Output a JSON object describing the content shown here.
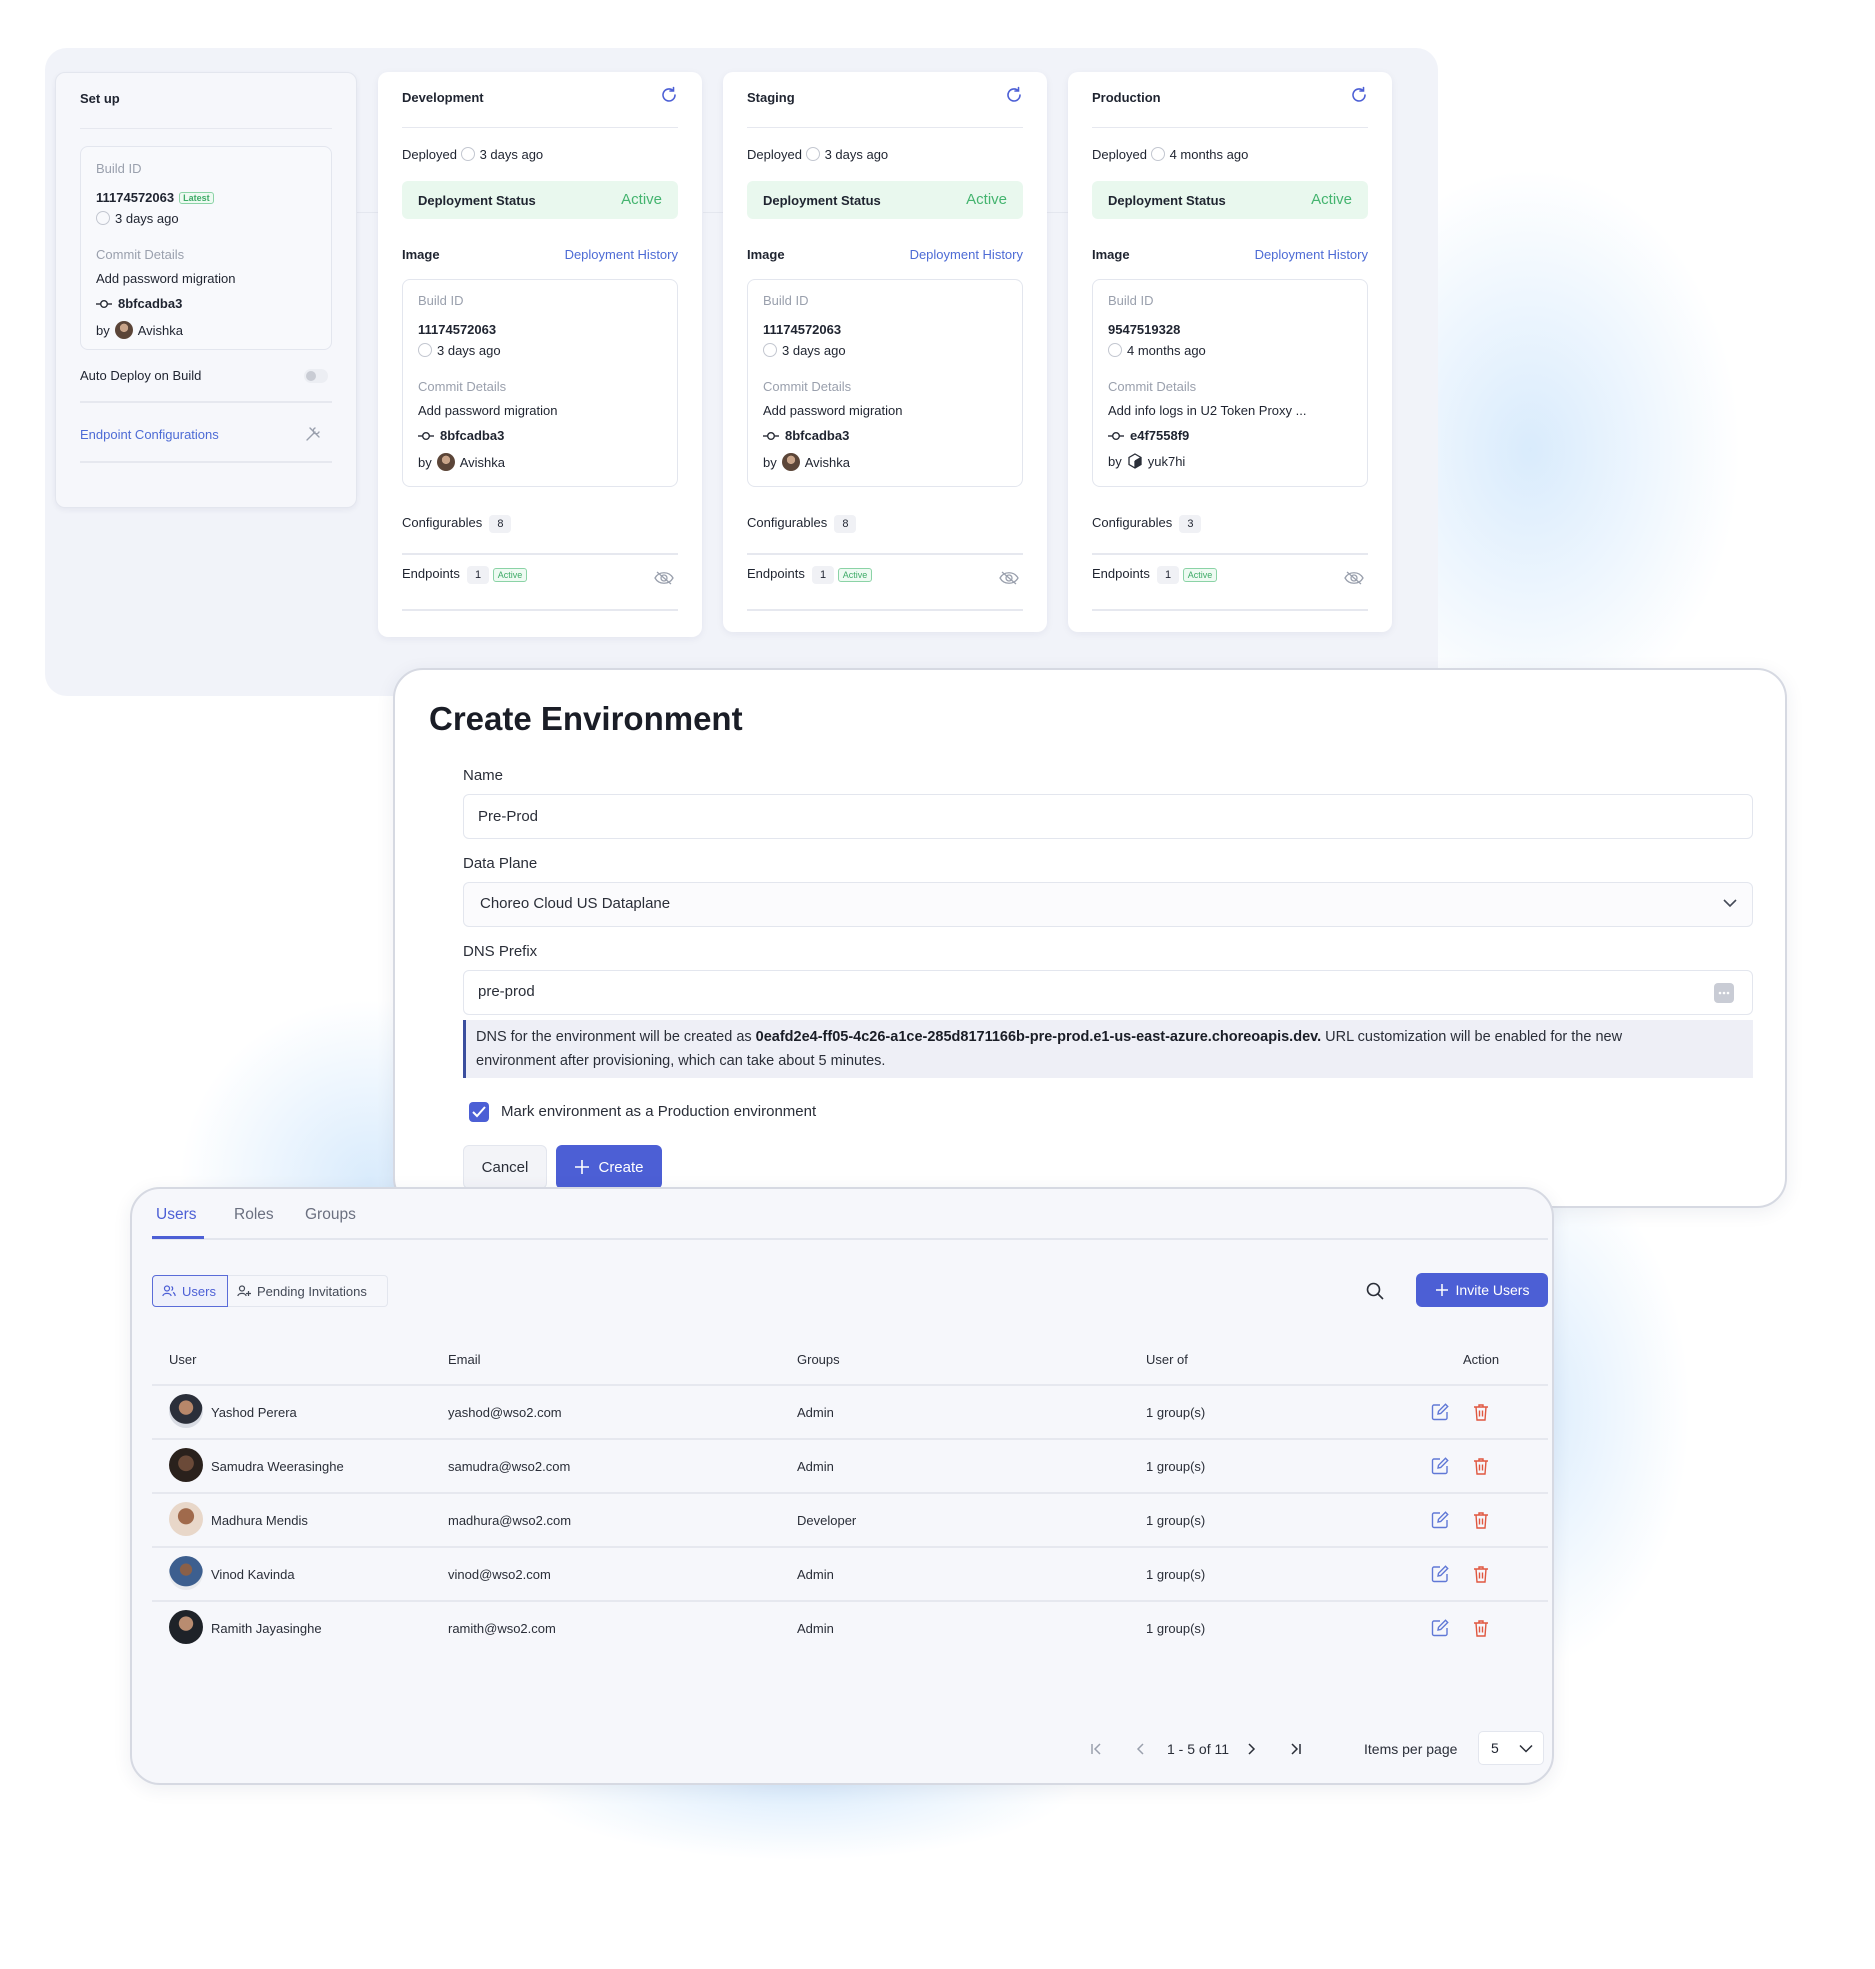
{
  "setup": {
    "title": "Set up",
    "build_id_label": "Build ID",
    "build_id": "11174572063",
    "latest_badge": "Latest",
    "time": "3 days ago",
    "commit_label": "Commit Details",
    "commit_message": "Add password migration",
    "commit_hash": "8bfcadba3",
    "by_label": "by",
    "author": "Avishka",
    "auto_deploy_label": "Auto Deploy on Build",
    "endpoint_config_label": "Endpoint Configurations"
  },
  "environments": [
    {
      "name": "Development",
      "deployed_label": "Deployed",
      "deployed_time": "3 days ago",
      "status_label": "Deployment Status",
      "status": "Active",
      "image_label": "Image",
      "history_link": "Deployment History",
      "build_id_label": "Build ID",
      "build_id": "11174572063",
      "build_time": "3 days ago",
      "commit_label": "Commit Details",
      "commit_message": "Add password migration",
      "commit_hash": "8bfcadba3",
      "by_label": "by",
      "author": "Avishka",
      "configurables_label": "Configurables",
      "configurables_count": "8",
      "endpoints_label": "Endpoints",
      "endpoints_count": "1",
      "endpoints_status": "Active"
    },
    {
      "name": "Staging",
      "deployed_label": "Deployed",
      "deployed_time": "3 days ago",
      "status_label": "Deployment Status",
      "status": "Active",
      "image_label": "Image",
      "history_link": "Deployment History",
      "build_id_label": "Build ID",
      "build_id": "11174572063",
      "build_time": "3 days ago",
      "commit_label": "Commit Details",
      "commit_message": "Add password migration",
      "commit_hash": "8bfcadba3",
      "by_label": "by",
      "author": "Avishka",
      "configurables_label": "Configurables",
      "configurables_count": "8",
      "endpoints_label": "Endpoints",
      "endpoints_count": "1",
      "endpoints_status": "Active"
    },
    {
      "name": "Production",
      "deployed_label": "Deployed",
      "deployed_time": "4 months ago",
      "status_label": "Deployment Status",
      "status": "Active",
      "image_label": "Image",
      "history_link": "Deployment History",
      "build_id_label": "Build ID",
      "build_id": "9547519328",
      "build_time": "4 months ago",
      "commit_label": "Commit Details",
      "commit_message": "Add info logs in U2 Token Proxy ...",
      "commit_hash": "e4f7558f9",
      "by_label": "by",
      "author": "yuk7hi",
      "configurables_label": "Configurables",
      "configurables_count": "3",
      "endpoints_label": "Endpoints",
      "endpoints_count": "1",
      "endpoints_status": "Active"
    }
  ],
  "create_env": {
    "title": "Create Environment",
    "name_label": "Name",
    "name_value": "Pre-Prod",
    "data_plane_label": "Data Plane",
    "data_plane_value": "Choreo Cloud US Dataplane",
    "dns_prefix_label": "DNS Prefix",
    "dns_prefix_value": "pre-prod",
    "info_prefix": "DNS for the environment will be created as ",
    "info_domain": "0eafd2e4-ff05-4c26-a1ce-285d8171166b-pre-prod.e1-us-east-azure.choreoapis.dev.",
    "info_suffix_line1": " URL customization will be enabled for the new",
    "info_line2": "environment after provisioning, which can take about 5 minutes.",
    "production_checkbox_label": "Mark environment as a Production environment",
    "cancel_label": "Cancel",
    "create_label": "Create"
  },
  "users_panel": {
    "tabs": [
      "Users",
      "Roles",
      "Groups"
    ],
    "filter_users": "Users",
    "filter_pending": "Pending Invitations",
    "invite_label": "Invite Users",
    "columns": [
      "User",
      "Email",
      "Groups",
      "User of",
      "Action"
    ],
    "rows": [
      {
        "name": "Yashod Perera",
        "email": "yashod@wso2.com",
        "groups": "Admin",
        "user_of": "1 group(s)"
      },
      {
        "name": "Samudra Weerasinghe",
        "email": "samudra@wso2.com",
        "groups": "Admin",
        "user_of": "1 group(s)"
      },
      {
        "name": "Madhura Mendis",
        "email": "madhura@wso2.com",
        "groups": "Developer",
        "user_of": "1 group(s)"
      },
      {
        "name": "Vinod Kavinda",
        "email": "vinod@wso2.com",
        "groups": "Admin",
        "user_of": "1 group(s)"
      },
      {
        "name": "Ramith Jayasinghe",
        "email": "ramith@wso2.com",
        "groups": "Admin",
        "user_of": "1 group(s)"
      }
    ],
    "pagination_text": "1 - 5 of 11",
    "items_per_page_label": "Items per page",
    "items_per_page_value": "5"
  },
  "colors": {
    "accent": "#4c5fd5",
    "active_green": "#44b46f",
    "danger": "#e0573f"
  }
}
